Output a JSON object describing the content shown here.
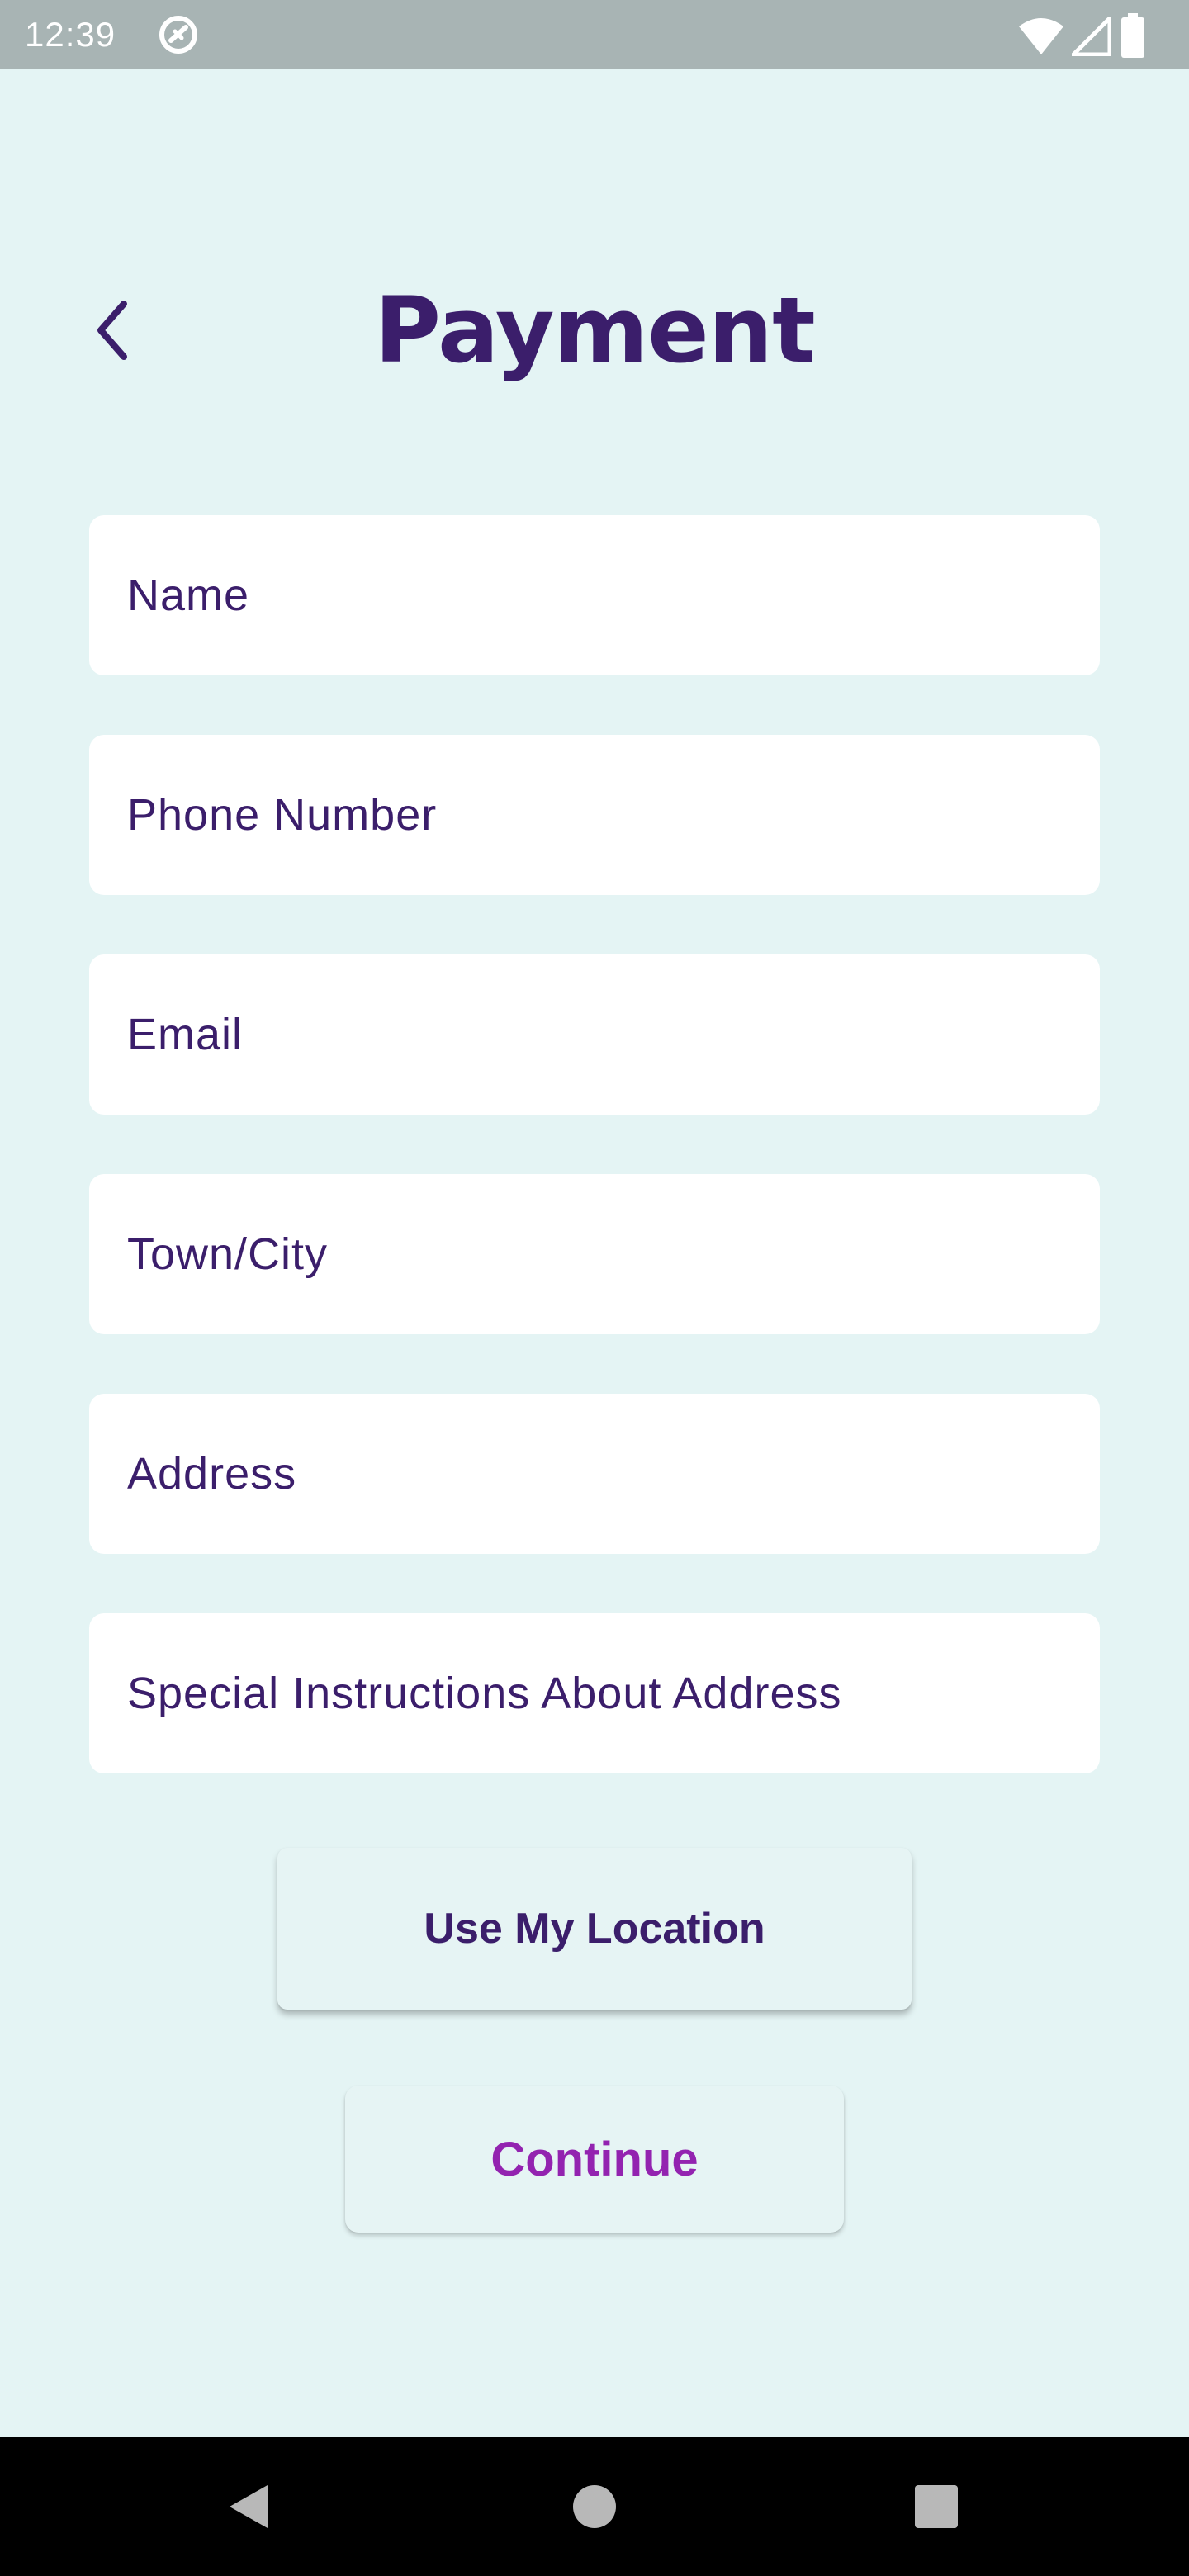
{
  "status_bar": {
    "time": "12:39",
    "icons": [
      "sync-icon",
      "wifi-icon",
      "signal-icon",
      "battery-icon"
    ]
  },
  "header": {
    "title": "Payment",
    "back_icon": "chevron-left-icon"
  },
  "form": {
    "fields": [
      {
        "placeholder": "Name",
        "value": ""
      },
      {
        "placeholder": "Phone Number",
        "value": ""
      },
      {
        "placeholder": "Email",
        "value": ""
      },
      {
        "placeholder": "Town/City",
        "value": ""
      },
      {
        "placeholder": "Address",
        "value": ""
      },
      {
        "placeholder": "Special Instructions About Address",
        "value": ""
      }
    ]
  },
  "buttons": {
    "use_location": "Use My Location",
    "continue": "Continue"
  },
  "nav_bar": {
    "icons": [
      "back-triangle-icon",
      "home-circle-icon",
      "recents-square-icon"
    ]
  },
  "colors": {
    "background": "#e4f4f4",
    "primary_text": "#3b1e6b",
    "accent": "#9323b0",
    "status_bar": "#a8b4b4",
    "nav_bar": "#000000"
  }
}
